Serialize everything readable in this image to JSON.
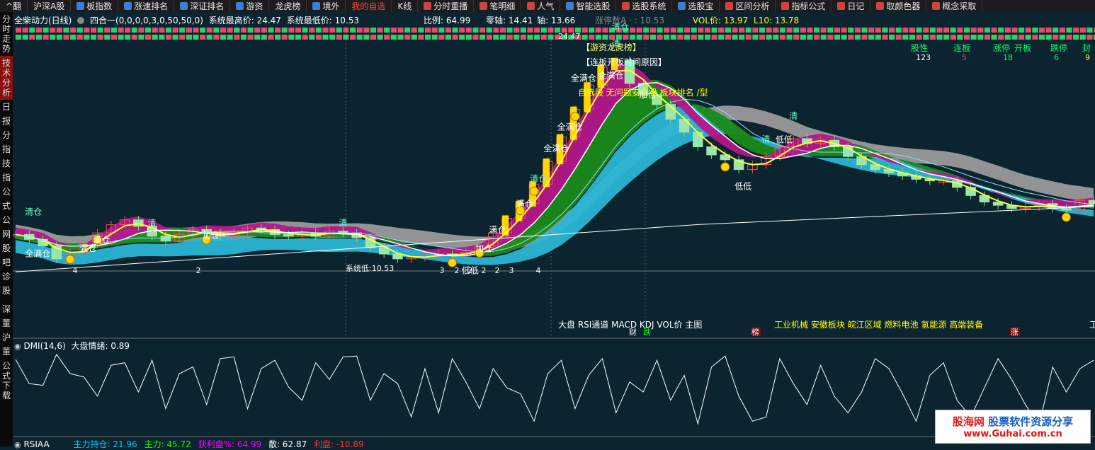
{
  "toolbar": {
    "items": [
      {
        "label": "^翻"
      },
      {
        "label": "沪深A股"
      },
      {
        "label": "板指数"
      },
      {
        "label": "涨速排名"
      },
      {
        "label": "深证排名"
      },
      {
        "label": "游资"
      },
      {
        "label": "龙虎榜"
      },
      {
        "label": "境外"
      },
      {
        "label": "我的自选"
      },
      {
        "label": "K线"
      },
      {
        "label": "分时重播"
      },
      {
        "label": "笔明细"
      },
      {
        "label": "人气"
      },
      {
        "label": "智能选股"
      },
      {
        "label": "选股系统"
      },
      {
        "label": "选股宝"
      },
      {
        "label": "区间分析"
      },
      {
        "label": "指标公式"
      },
      {
        "label": "日记"
      },
      {
        "label": "取颜色器"
      },
      {
        "label": "概念采取"
      }
    ]
  },
  "sidebar": {
    "items": [
      {
        "label": "分时走势"
      },
      {
        "label": "技术分析"
      },
      {
        "label": "日"
      },
      {
        "label": "报"
      },
      {
        "label": "分"
      },
      {
        "label": "指"
      },
      {
        "label": "技"
      },
      {
        "label": "指"
      },
      {
        "label": "公"
      },
      {
        "label": "式"
      },
      {
        "label": "公"
      },
      {
        "label": "网"
      },
      {
        "label": "股"
      },
      {
        "label": "吧"
      },
      {
        "label": "诊"
      },
      {
        "label": "股"
      },
      {
        "label": "深"
      },
      {
        "label": "董"
      },
      {
        "label": "沪"
      },
      {
        "label": "董"
      },
      {
        "label": "公式下载"
      }
    ]
  },
  "main_header": {
    "title": "全柴动力(日线)",
    "indicator": "四合一(0,0,0,0,3,0,50,50,0)",
    "sys_high": "系统最高价: 24.47",
    "sys_low": "系统最低价: 10.53",
    "ratio": "比例: 64.99",
    "zero_axis": "零轴: 14.41",
    "axis": "轴: 13.66",
    "limit_up": "涨停数A · : 10.53",
    "vol_price": "VOL价: 13.97",
    "l10": "L10: 13.78"
  },
  "stats_header": {
    "labels": [
      "股性",
      "连板",
      "涨停",
      "开板",
      "跌停",
      "封"
    ],
    "values": [
      "123",
      "5",
      "18",
      "6",
      "9"
    ]
  },
  "annotations": {
    "dragon_list": "【游资龙虎榜】",
    "board_reason": "【连板开板时间原因】",
    "self_select": "自选股 无问题安全股 板块排名 /型",
    "peak_label": "24.47",
    "low_label": "系统低:10.53",
    "sectors": "工业机械 安徽板块 皖江区域 燃料电池 氢能源 高端装备",
    "tabs_row": "大盘  RSI通道   MACD   KDJ   VOL价 主图",
    "cai": "财",
    "die": "跌",
    "bang": "榜",
    "zhang": "涨",
    "gong": "工",
    "signals": [
      {
        "text": "清仓"
      },
      {
        "text": "全满仓"
      },
      {
        "text": "满仓"
      },
      {
        "text": "满仓"
      },
      {
        "text": "加仓"
      },
      {
        "text": "清"
      },
      {
        "text": "清"
      },
      {
        "text": "加仓"
      },
      {
        "text": "满仓"
      },
      {
        "text": "满仓"
      },
      {
        "text": "低低"
      },
      {
        "text": "清仓"
      },
      {
        "text": "全满仓"
      },
      {
        "text": "全满仓"
      },
      {
        "text": "全满仓"
      },
      {
        "text": "清仓"
      },
      {
        "text": "全满仓"
      },
      {
        "text": "清"
      },
      {
        "text": "清"
      },
      {
        "text": "加仓"
      },
      {
        "text": "清"
      },
      {
        "text": "低低"
      },
      {
        "text": "低低"
      },
      {
        "text": "清"
      }
    ],
    "counts": [
      "4",
      "2",
      "3",
      "2",
      "2",
      "2",
      "2",
      "3",
      "4"
    ]
  },
  "dmi_header": {
    "title": "DMI(14,6)",
    "sentiment": "大盘情绪: 0.89"
  },
  "bottom_header": {
    "title": "RSIAA",
    "main_hold": "主力持仓: 21.96",
    "main_force": "主力: 45.72",
    "profit_ratio": "获利盘%: 64.99",
    "retail": "散: 62.87",
    "profit": "利盘: -10.89"
  },
  "watermark": {
    "line1a": "股海网",
    "line1b": "股票软件资源分享",
    "line2": "www.Guhai.com.cn"
  },
  "chart_data": {
    "type": "candlestick",
    "title": "全柴动力(日线)",
    "ylim": [
      10.53,
      24.47
    ],
    "close": [
      13.3,
      13.0,
      12.6,
      11.8,
      12.2,
      12.7,
      13.4,
      13.9,
      14.2,
      13.8,
      13.2,
      12.9,
      13.3,
      13.6,
      13.4,
      13.2,
      13.5,
      13.7,
      13.6,
      13.3,
      13.2,
      13.4,
      13.2,
      13.5,
      13.4,
      13.1,
      12.5,
      12.1,
      11.8,
      11.9,
      12.0,
      12.1,
      12.0,
      12.2,
      12.6,
      13.4,
      14.3,
      15.2,
      16.4,
      17.8,
      19.3,
      21.0,
      22.5,
      23.6,
      24.0,
      22.6,
      21.9,
      21.3,
      20.4,
      19.6,
      18.7,
      18.2,
      17.9,
      17.3,
      17.6,
      18.1,
      18.7,
      19.2,
      18.9,
      19.1,
      18.7,
      18.1,
      17.6,
      17.3,
      17.1,
      16.9,
      16.7,
      16.6,
      16.6,
      16.2,
      15.7,
      15.3,
      15.1,
      14.9,
      15.0,
      15.2,
      14.9,
      14.8,
      15.4,
      15.2
    ],
    "dmi": [
      0.89,
      0.6,
      0.58,
      0.95,
      0.72,
      0.68,
      0.45,
      0.82,
      0.85,
      0.5,
      0.88,
      0.3,
      0.72,
      0.8,
      0.35,
      0.9,
      0.92,
      0.3,
      0.78,
      0.88,
      0.56,
      0.4,
      0.85,
      0.65,
      0.92,
      0.93,
      0.4,
      0.72,
      0.6,
      0.2,
      0.78,
      0.25,
      0.9,
      0.62,
      0.3,
      0.78,
      0.55,
      0.48,
      0.15,
      0.72,
      0.88,
      0.3,
      0.7,
      0.9,
      0.25,
      0.62,
      0.5,
      0.88,
      0.4,
      0.7,
      0.12,
      0.8,
      0.93,
      0.45,
      0.15,
      0.2,
      0.9,
      0.6,
      0.35,
      0.82,
      0.45,
      0.25,
      0.5,
      0.9,
      0.78,
      0.48,
      0.15,
      0.7,
      0.85,
      0.4,
      0.2,
      0.55,
      0.9,
      0.65,
      0.35,
      0.1,
      0.8,
      0.5,
      0.78,
      0.88
    ]
  }
}
